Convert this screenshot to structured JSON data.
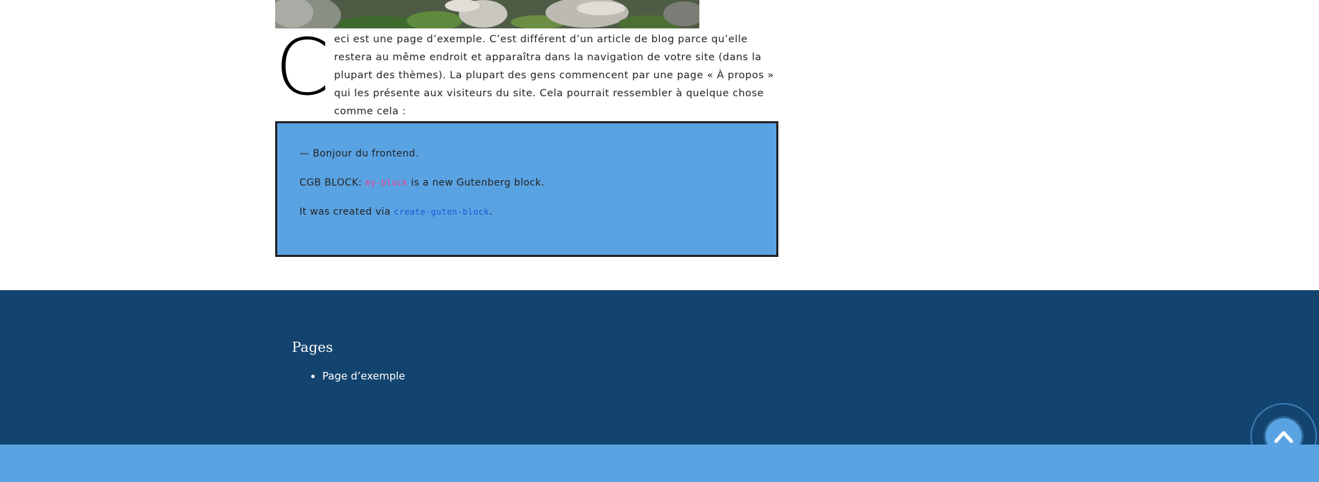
{
  "content": {
    "drop_cap": "C",
    "intro_text": "eci est une page d’exemple. C’est différent d’un article de blog parce qu’elle restera au même endroit et apparaîtra dans la navigation de votre site (dans la plupart des thèmes). La plupart des gens commencent par une page « À propos » qui les présente aux visiteurs du site. Cela pourrait ressembler à quelque chose comme cela :"
  },
  "cgb_block": {
    "greeting": "— Bonjour du frontend.",
    "line2_prefix": "CGB BLOCK: ",
    "line2_code": "my-block",
    "line2_suffix": " is a new Gutenberg block.",
    "line3_prefix": "It was created via ",
    "line3_link": "create-guten-block",
    "line3_suffix": "."
  },
  "footer": {
    "widget_title": "Pages",
    "items": [
      {
        "label": "Page d’exemple"
      }
    ]
  },
  "icons": {
    "scroll_top": "chevron-up-icon"
  },
  "colors": {
    "footer_bg": "#13446f",
    "block_bg": "#5aa3e3",
    "code_pink": "#e8438d",
    "code_blue": "#1a56d6"
  }
}
